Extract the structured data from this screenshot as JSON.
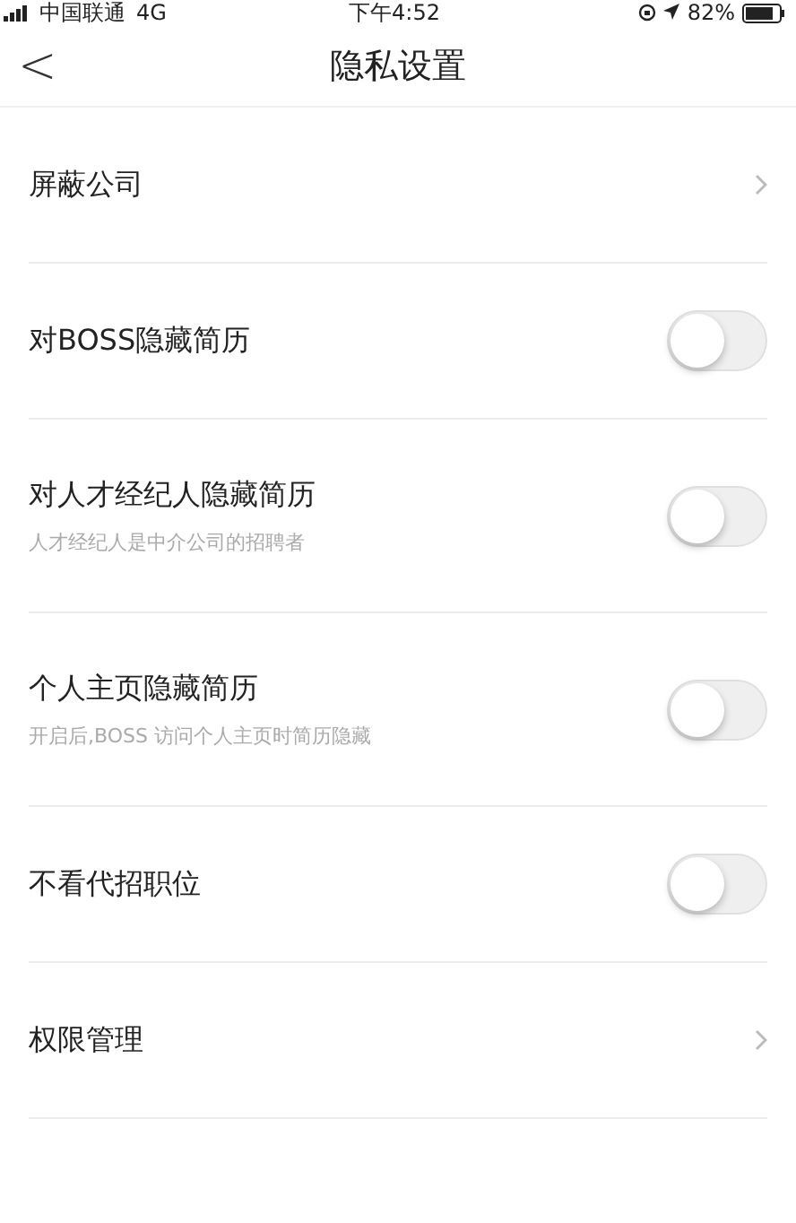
{
  "status_bar": {
    "carrier": "中国联通",
    "network": "4G",
    "time": "下午4:52",
    "battery": "82%"
  },
  "nav": {
    "back": "<",
    "title": "隐私设置"
  },
  "items": [
    {
      "kind": "link",
      "label": "屏蔽公司"
    },
    {
      "kind": "toggle",
      "label": "对BOSS隐藏简历",
      "on": false
    },
    {
      "kind": "toggle",
      "label": "对人才经纪人隐藏简历",
      "hint": "人才经纪人是中介公司的招聘者",
      "on": false
    },
    {
      "kind": "toggle",
      "label": "个人主页隐藏简历",
      "hint": "开启后,BOSS 访问个人主页时简历隐藏",
      "on": false
    },
    {
      "kind": "toggle",
      "label": "不看代招职位",
      "on": false
    },
    {
      "kind": "link",
      "label": "权限管理"
    }
  ]
}
